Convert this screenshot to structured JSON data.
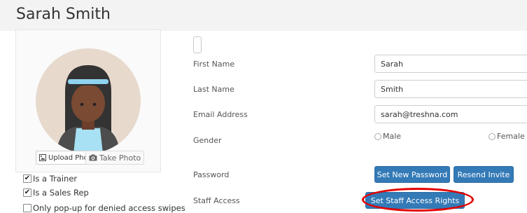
{
  "profile": {
    "name": "Sarah Smith",
    "upload_photo_label": "Upload Photo",
    "take_photo_label": "Take Photo"
  },
  "checkboxes": [
    {
      "label": "Is a Trainer",
      "checked": true
    },
    {
      "label": "Is a Sales Rep",
      "checked": true
    },
    {
      "label": "Only pop-up for denied access swipes",
      "checked": false
    }
  ],
  "form": {
    "first_name_label": "First Name",
    "first_name_value": "Sarah",
    "last_name_label": "Last Name",
    "last_name_value": "Smith",
    "email_label": "Email Address",
    "email_value": "sarah@treshna.com",
    "gender_label": "Gender",
    "gender_options": [
      "Male",
      "Female"
    ],
    "password_label": "Password",
    "set_new_password_label": "Set New Password",
    "resend_invite_label": "Resend Invite",
    "staff_access_label": "Staff Access",
    "set_staff_access_label": "Set Staff Access Rights"
  },
  "icons": {
    "upload": "upload-image-icon",
    "camera": "camera-icon",
    "check": "checkmark-icon"
  },
  "colors": {
    "primary_button": "#337ab7",
    "annotation": "#e30000",
    "avatar_bg": "#e7d9cc",
    "skin": "#7a4a33",
    "hair": "#333333",
    "headband": "#8fd3f0",
    "shirt": "#a8e0f4"
  }
}
